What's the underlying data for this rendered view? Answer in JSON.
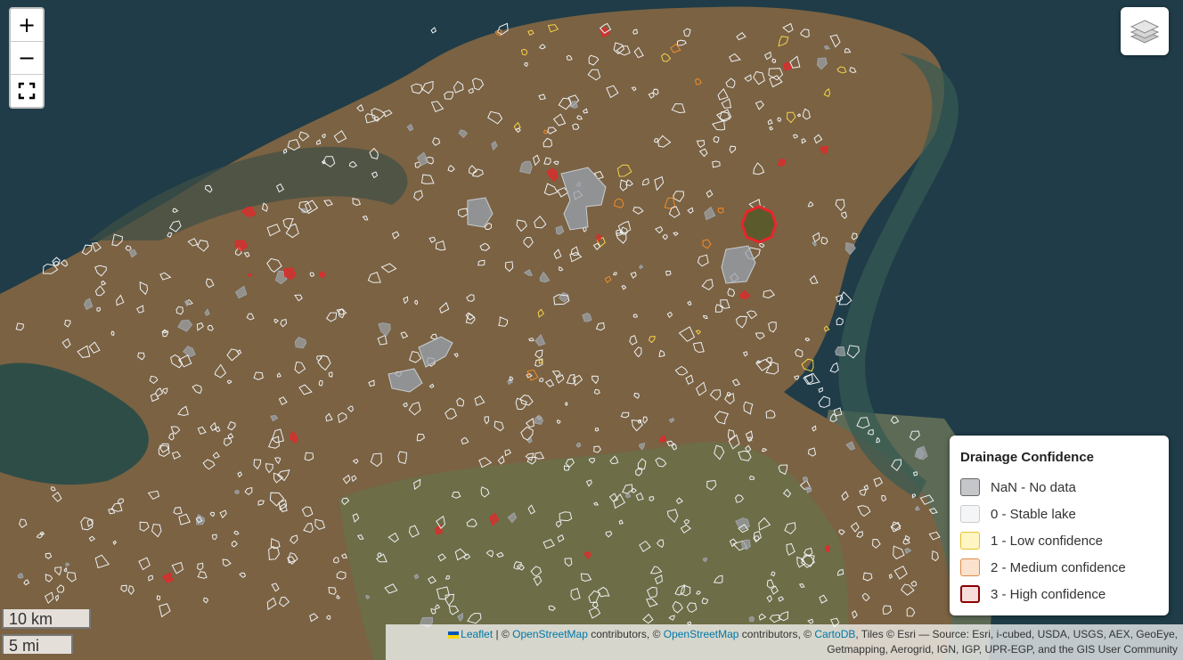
{
  "map": {
    "zoom_in_label": "+",
    "zoom_out_label": "−",
    "fullscreen_icon": "fullscreen-icon",
    "layers_icon": "layers-icon",
    "colors": {
      "sea": "#1e3b47",
      "land": "#7a6242",
      "lagoon": "#2e4c46",
      "nan": "#9ea3a8",
      "stable": "#eef0f2",
      "low": "#f5d34a",
      "medium": "#f08c2a",
      "high": "#e8262a"
    }
  },
  "legend": {
    "title": "Drainage Confidence",
    "items": [
      {
        "label": "NaN - No data",
        "fill": "#c4c6c9",
        "border": "#666666"
      },
      {
        "label": "0 - Stable lake",
        "fill": "#f4f5f6",
        "border": "#cccccc"
      },
      {
        "label": "1 - Low confidence",
        "fill": "#fff6c4",
        "border": "#e8c22a"
      },
      {
        "label": "2 - Medium confidence",
        "fill": "#fbe2cd",
        "border": "#e08a45"
      },
      {
        "label": "3 - High confidence",
        "fill": "#f8dbdb",
        "border": "#8b0000"
      }
    ]
  },
  "scale": {
    "km": "10 km",
    "mi": "5 mi"
  },
  "attribution": {
    "leaflet": "Leaflet",
    "sep1": " | © ",
    "osm1": "OpenStreetMap",
    "contrib1": " contributors, © ",
    "osm2": "OpenStreetMap",
    "contrib2": " contributors, © ",
    "carto": "CartoDB",
    "tiles": ", Tiles © Esri — Source: Esri, i-cubed, USDA, USGS, AEX, GeoEye,",
    "line2": "Getmapping, Aerogrid, IGN, IGP, UPR-EGP, and the GIS User Community"
  }
}
